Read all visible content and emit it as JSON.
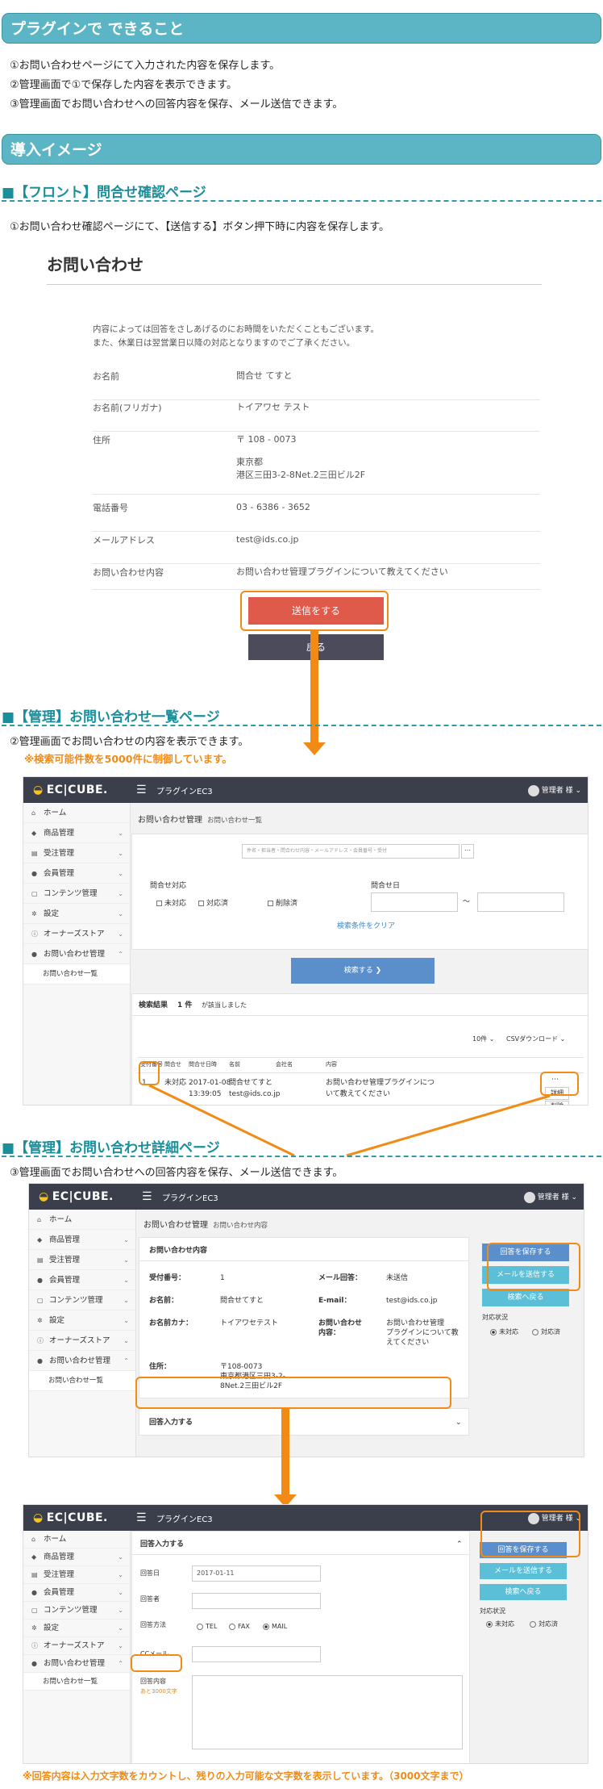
{
  "section1": {
    "title": "プラグインで できること",
    "items": [
      "①お問い合わせページにて入力された内容を保存します。",
      "②管理画面で①で保存した内容を表示できます。",
      "③管理画面でお問い合わせへの回答内容を保存、メール送信できます。"
    ]
  },
  "section2": {
    "title": "導入イメージ"
  },
  "front": {
    "heading": "■【フロント】問合せ確認ページ",
    "desc": "①お問い合わせ確認ページにて、【送信する】ボタン押下時に内容を保存します。",
    "form_title": "お問い合わせ",
    "intro1": "内容によっては回答をさしあげるのにお時間をいただくこともございます。",
    "intro2": "また、休業日は翌営業日以降の対応となりますのでご了承ください。",
    "rows": [
      {
        "label": "お名前",
        "value": "問合せ てすと"
      },
      {
        "label": "お名前(フリガナ)",
        "value": "トイアワセ テスト"
      },
      {
        "label": "住所",
        "value": "〒 108 - 0073",
        "value2": "東京都",
        "value3": "港区三田3-2-8Net.2三田ビル2F"
      },
      {
        "label": "電話番号",
        "value": "03 - 6386 - 3652"
      },
      {
        "label": "メールアドレス",
        "value": "test@ids.co.jp"
      },
      {
        "label": "お問い合わせ内容",
        "value": "お問い合わせ管理プラグインについて教えてください"
      }
    ],
    "send_label": "送信をする",
    "back_label": "戻る"
  },
  "admin_list": {
    "heading": "■【管理】お問い合わせ一覧ページ",
    "desc": "②管理画面でお問い合わせの内容を表示できます。",
    "note": "※検索可能件数を5000件に制御しています。",
    "logo": "EC|CUBE.",
    "shop": "プラグインEC3",
    "user": "管理者 様",
    "crumb": "お問い合わせ管理",
    "crumb_sub": "お問い合わせ一覧",
    "search_placeholder": "件名・担当者・問合わせ内容・メールアドレス・会員番号・受付",
    "filter_status_label": "問合せ対応",
    "status_options": [
      "未対応",
      "対応済",
      "削除済"
    ],
    "filter_date_label": "問合せ日",
    "date_sep": "〜",
    "clear_link": "検索条件をクリア",
    "search_button": "検索する ❯",
    "result_label": "検索結果",
    "result_count": "1 件",
    "result_suffix": "が該当しました",
    "per_page": "10件 ⌄",
    "csv": "CSVダウンロード ⌄",
    "columns": [
      "受付番号",
      "問合せ",
      "問合せ日時",
      "名前",
      "会社名",
      "内容"
    ],
    "row": {
      "id": "1",
      "status": "未対応",
      "date": "2017-01-08",
      "time": "13:39:05",
      "name": "問合せてすと",
      "email": "test@ids.co.jp",
      "company": "",
      "content": "お問い合わせ管理プラグインにつ",
      "content2": "いて教えてください"
    },
    "detail_button": "詳細",
    "delete_button": "削除"
  },
  "sidebar": {
    "items": [
      "ホーム",
      "商品管理",
      "受注管理",
      "会員管理",
      "コンテンツ管理",
      "設定",
      "オーナーズストア",
      "お問い合わせ管理"
    ],
    "sub": "お問い合わせ一覧"
  },
  "admin_detail": {
    "heading": "■【管理】お問い合わせ詳細ページ",
    "desc": "③管理画面でお問い合わせへの回答内容を保存、メール送信できます。",
    "crumb": "お問い合わせ管理",
    "crumb_sub": "お問い合わせ内容",
    "panel_title": "お問い合わせ内容",
    "fields": {
      "id_label": "受付番号：",
      "id": "1",
      "mail_label": "メール回答：",
      "mail": "未送信",
      "name_label": "お名前：",
      "name": "問合せてすと",
      "email_label": "E-mail：",
      "email": "test@ids.co.jp",
      "kana_label": "お名前カナ：",
      "kana": "トイアワセテスト",
      "content_label1": "お問い合わせ",
      "content_label2": "内容：",
      "content1": "お問い合わせ管理",
      "content2": "プラグインについて教",
      "content3": "えてください",
      "addr_label": "住所：",
      "addr1": "〒108-0073",
      "addr2": "東京都港区三田3-2-",
      "addr3": "8Net.2三田ビル2F"
    },
    "answer_toggle": "回答入力する",
    "save_button": "回答を保存する",
    "mail_button": "メールを送信する",
    "back_button": "検索へ戻る",
    "status_label": "対応状況",
    "status_options": [
      "未対応",
      "対応済"
    ]
  },
  "admin_answer": {
    "panel_title": "回答入力する",
    "date_label": "回答日",
    "date": "2017-01-11",
    "person_label": "回答者",
    "method_label": "回答方法",
    "methods": [
      "TEL",
      "FAX",
      "MAIL"
    ],
    "cc_label": "CCメール",
    "content_label": "回答内容",
    "counter": "あと3000文字",
    "note": "※回答内容は入力文字数をカウントし、残りの入力可能な文字数を表示しています。（3000文字まで）"
  }
}
